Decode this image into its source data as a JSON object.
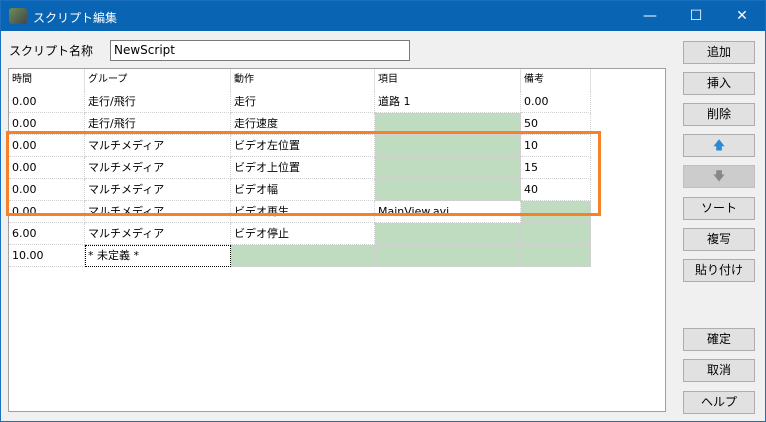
{
  "window": {
    "title": "スクリプト編集",
    "minimize": "—",
    "maximize": "☐",
    "close": "✕"
  },
  "script_name": {
    "label": "スクリプト名称",
    "value": "NewScript"
  },
  "table": {
    "headers": [
      "時間",
      "グループ",
      "動作",
      "項目",
      "備考"
    ],
    "rows": [
      [
        "0.00",
        "走行/飛行",
        "走行",
        "道路 1",
        "0.00"
      ],
      [
        "0.00",
        "走行/飛行",
        "走行速度",
        "",
        "50"
      ],
      [
        "0.00",
        "マルチメディア",
        "ビデオ左位置",
        "",
        "10"
      ],
      [
        "0.00",
        "マルチメディア",
        "ビデオ上位置",
        "",
        "15"
      ],
      [
        "0.00",
        "マルチメディア",
        "ビデオ幅",
        "",
        "40"
      ],
      [
        "0.00",
        "マルチメディア",
        "ビデオ再生",
        "MainView.avi",
        ""
      ],
      [
        "6.00",
        "マルチメディア",
        "ビデオ停止",
        "",
        ""
      ],
      [
        "10.00",
        "* 未定義 *",
        "",
        "",
        ""
      ]
    ]
  },
  "buttons": {
    "add": "追加",
    "insert": "挿入",
    "delete": "削除",
    "up": "🡅",
    "down": "🡇",
    "sort": "ソート",
    "copy": "複写",
    "paste": "貼り付け",
    "ok": "確定",
    "cancel": "取消",
    "help": "ヘルプ"
  },
  "highlight_color": "#f5822a"
}
